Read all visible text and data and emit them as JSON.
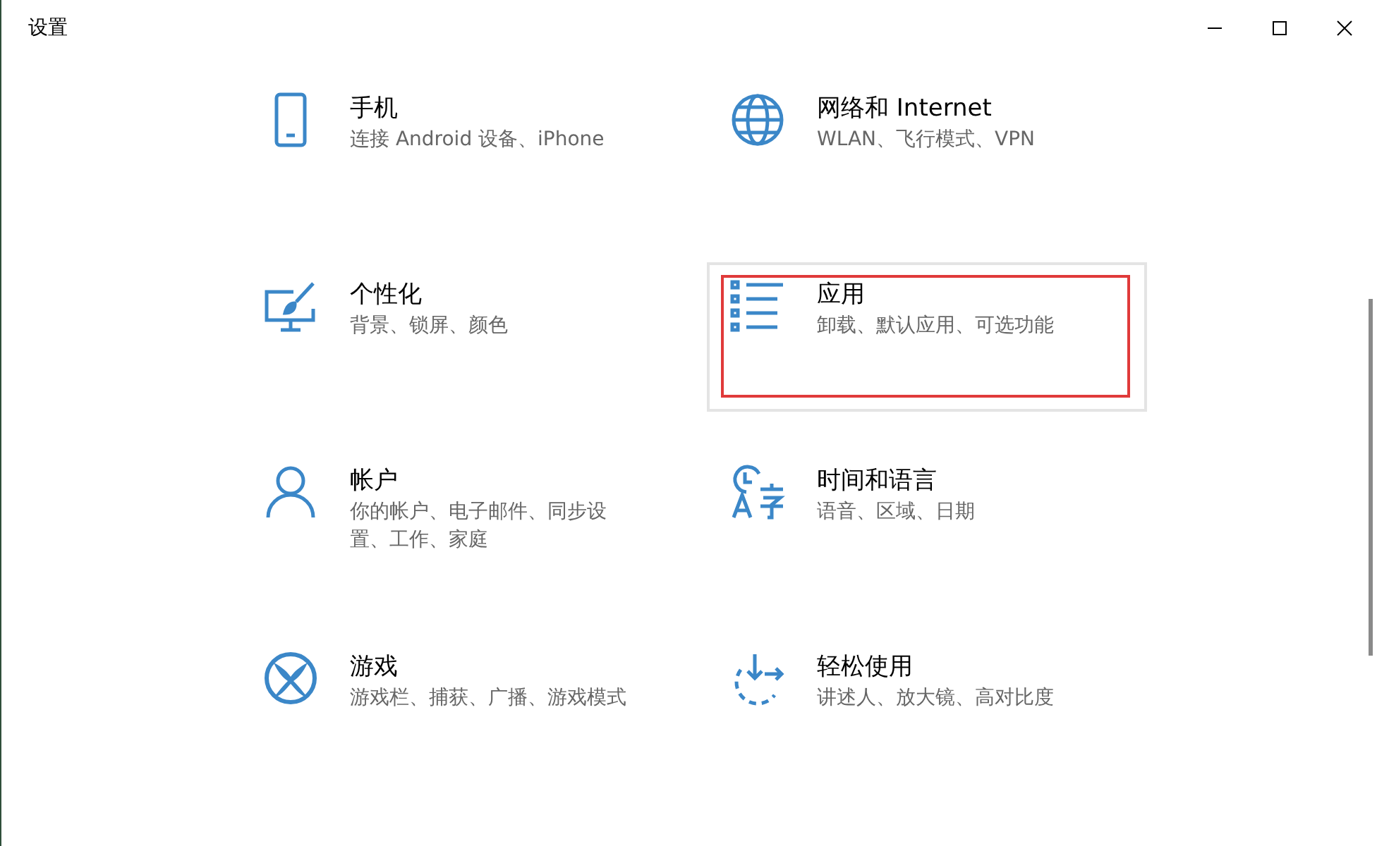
{
  "window": {
    "title": "设置"
  },
  "tiles": [
    {
      "title": "手机",
      "subtitle": "连接 Android 设备、iPhone",
      "hovered": false,
      "highlighted": false
    },
    {
      "title": "网络和 Internet",
      "subtitle": "WLAN、飞行模式、VPN",
      "hovered": false,
      "highlighted": false
    },
    {
      "title": "个性化",
      "subtitle": "背景、锁屏、颜色",
      "hovered": false,
      "highlighted": false
    },
    {
      "title": "应用",
      "subtitle": "卸载、默认应用、可选功能",
      "hovered": true,
      "highlighted": true
    },
    {
      "title": "帐户",
      "subtitle": [
        "你的帐户、电子邮件、同步设",
        "置、工作、家庭"
      ],
      "hovered": false,
      "highlighted": false
    },
    {
      "title": "时间和语言",
      "subtitle": "语音、区域、日期",
      "hovered": false,
      "highlighted": false
    },
    {
      "title": "游戏",
      "subtitle": "游戏栏、捕获、广播、游戏模式",
      "hovered": false,
      "highlighted": false
    },
    {
      "title": "轻松使用",
      "subtitle": "讲述人、放大镜、高对比度",
      "hovered": false,
      "highlighted": false
    }
  ]
}
